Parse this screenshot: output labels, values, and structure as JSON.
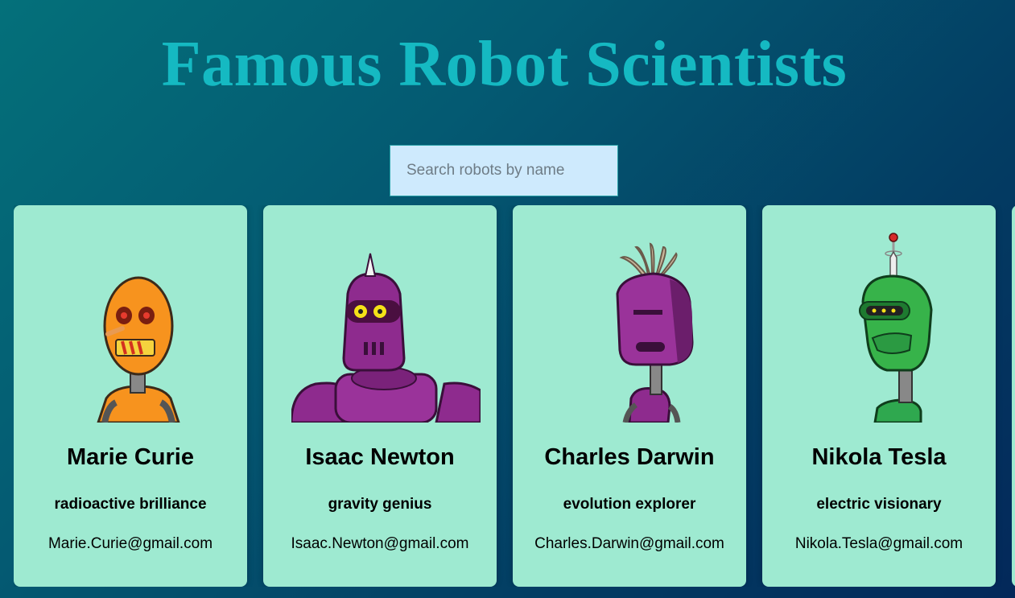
{
  "page": {
    "title": "Famous Robot Scientists"
  },
  "search": {
    "placeholder": "Search robots by name"
  },
  "robots": [
    {
      "name": "Marie Curie",
      "tagline": "radioactive brilliance",
      "email": "Marie.Curie@gmail.com",
      "icon": "orange-robot-icon",
      "color": "#f7931e"
    },
    {
      "name": "Isaac Newton",
      "tagline": "gravity genius",
      "email": "Isaac.Newton@gmail.com",
      "icon": "purple-horned-robot-icon",
      "color": "#8e2b8e"
    },
    {
      "name": "Charles Darwin",
      "tagline": "evolution explorer",
      "email": "Charles.Darwin@gmail.com",
      "icon": "purple-mop-robot-icon",
      "color": "#8e2b8e"
    },
    {
      "name": "Nikola Tesla",
      "tagline": "electric visionary",
      "email": "Nikola.Tesla@gmail.com",
      "icon": "green-antenna-robot-icon",
      "color": "#2fa84f"
    }
  ],
  "colors": {
    "title": "#15b9c2",
    "card": "#9eead1",
    "search_bg": "#ceeafd"
  }
}
